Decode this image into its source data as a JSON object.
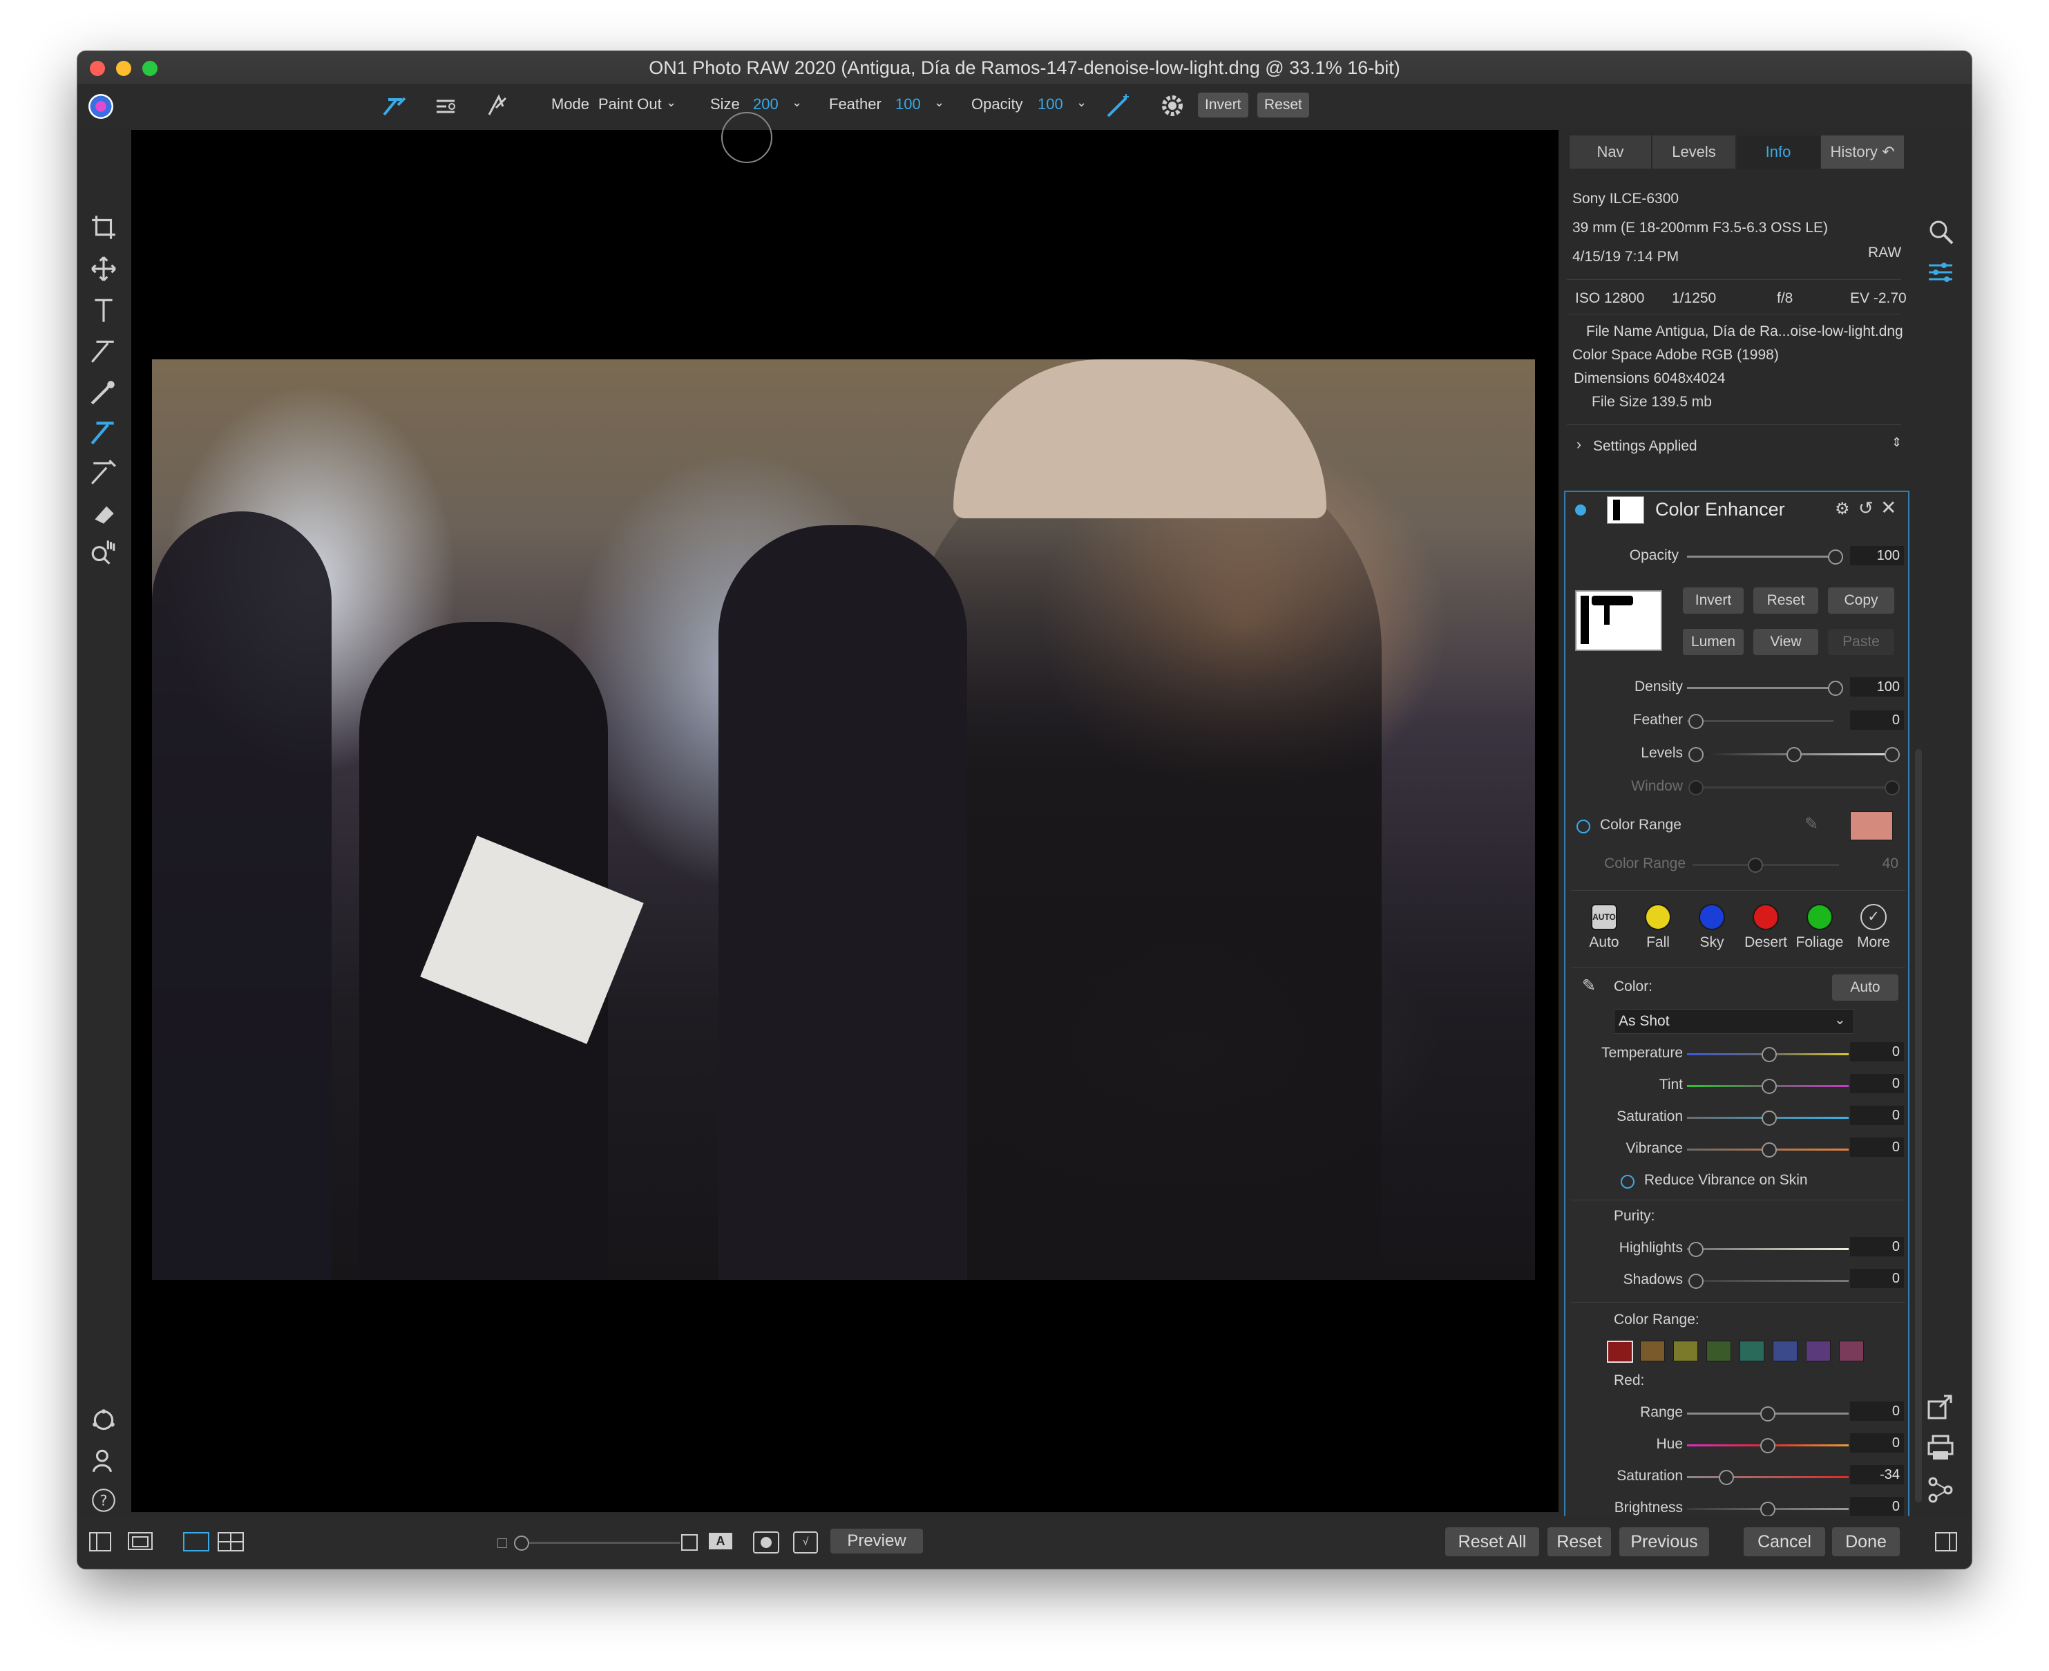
{
  "window": {
    "title": "ON1 Photo RAW 2020 (Antigua, Día de Ramos-147-denoise-low-light.dng @ 33.1% 16-bit)"
  },
  "toolbar": {
    "mode_label": "Mode",
    "mode_value": "Paint Out",
    "size_label": "Size",
    "size_value": "200",
    "feather_label": "Feather",
    "feather_value": "100",
    "opacity_label": "Opacity",
    "opacity_value": "100",
    "invert_label": "Invert",
    "reset_label": "Reset"
  },
  "tabs": [
    {
      "label": "Nav"
    },
    {
      "label": "Levels"
    },
    {
      "label": "Info"
    },
    {
      "label": "History"
    }
  ],
  "info": {
    "camera": "Sony ILCE-6300",
    "lens": "39 mm (E 18-200mm F3.5-6.3 OSS LE)",
    "date": "4/15/19 7:14 PM",
    "format": "RAW",
    "iso": "ISO 12800",
    "shutter": "1/1250",
    "aperture": "f/8",
    "ev": "EV -2.70",
    "file_name": "File Name Antigua, Día de Ra...oise-low-light.dng",
    "color_space": "Color Space Adobe RGB (1998)",
    "dimensions": "Dimensions 6048x4024",
    "file_size": "File Size 139.5 mb",
    "settings_applied": "Settings Applied"
  },
  "enhancer": {
    "title": "Color Enhancer",
    "opacity_label": "Opacity",
    "opacity_value": "100",
    "invert": "Invert",
    "reset": "Reset",
    "copy": "Copy",
    "lumen": "Lumen",
    "view": "View",
    "paste": "Paste",
    "density_label": "Density",
    "density_value": "100",
    "feather_label": "Feather",
    "feather_value": "0",
    "levels_label": "Levels",
    "window_label": "Window",
    "color_range_label": "Color Range",
    "color_range_swatch": "#d48a7c",
    "color_range_slider_label": "Color Range",
    "color_range_slider_value": "40",
    "presets": [
      {
        "label": "Auto",
        "color": "#cfcfcf"
      },
      {
        "label": "Fall",
        "color": "#e8d21a"
      },
      {
        "label": "Sky",
        "color": "#1a3fd8"
      },
      {
        "label": "Desert",
        "color": "#d81a1a"
      },
      {
        "label": "Foliage",
        "color": "#1ab81a"
      },
      {
        "label": "More",
        "color": "#cfcfcf"
      }
    ],
    "auto_badge": "AUTO",
    "color_label": "Color:",
    "auto_button": "Auto",
    "wb_value": "As Shot",
    "temperature_label": "Temperature",
    "temperature_value": "0",
    "tint_label": "Tint",
    "tint_value": "0",
    "saturation_label": "Saturation",
    "saturation_value": "0",
    "vibrance_label": "Vibrance",
    "vibrance_value": "0",
    "reduce_vibrance_label": "Reduce Vibrance on Skin",
    "purity_label": "Purity:",
    "highlights_label": "Highlights",
    "highlights_value": "0",
    "shadows_label": "Shadows",
    "shadows_value": "0",
    "color_range_section_label": "Color Range:",
    "range_swatches": [
      "#8a1a1a",
      "#7a5a2a",
      "#7a7a2a",
      "#3a5a2a",
      "#2a6a5a",
      "#3a4a8a",
      "#5a3a7a",
      "#7a3a5a"
    ],
    "red_label": "Red:",
    "range_label": "Range",
    "range_value": "0",
    "hue_label": "Hue",
    "hue_value": "0",
    "red_saturation_label": "Saturation",
    "red_saturation_value": "-34",
    "brightness_label": "Brightness",
    "brightness_value": "0"
  },
  "bottom": {
    "preview": "Preview",
    "reset_all": "Reset All",
    "reset": "Reset",
    "previous": "Previous",
    "cancel": "Cancel",
    "done": "Done"
  },
  "colors": {
    "accent": "#3aa9e6",
    "panel_border": "#2f7fb0"
  }
}
